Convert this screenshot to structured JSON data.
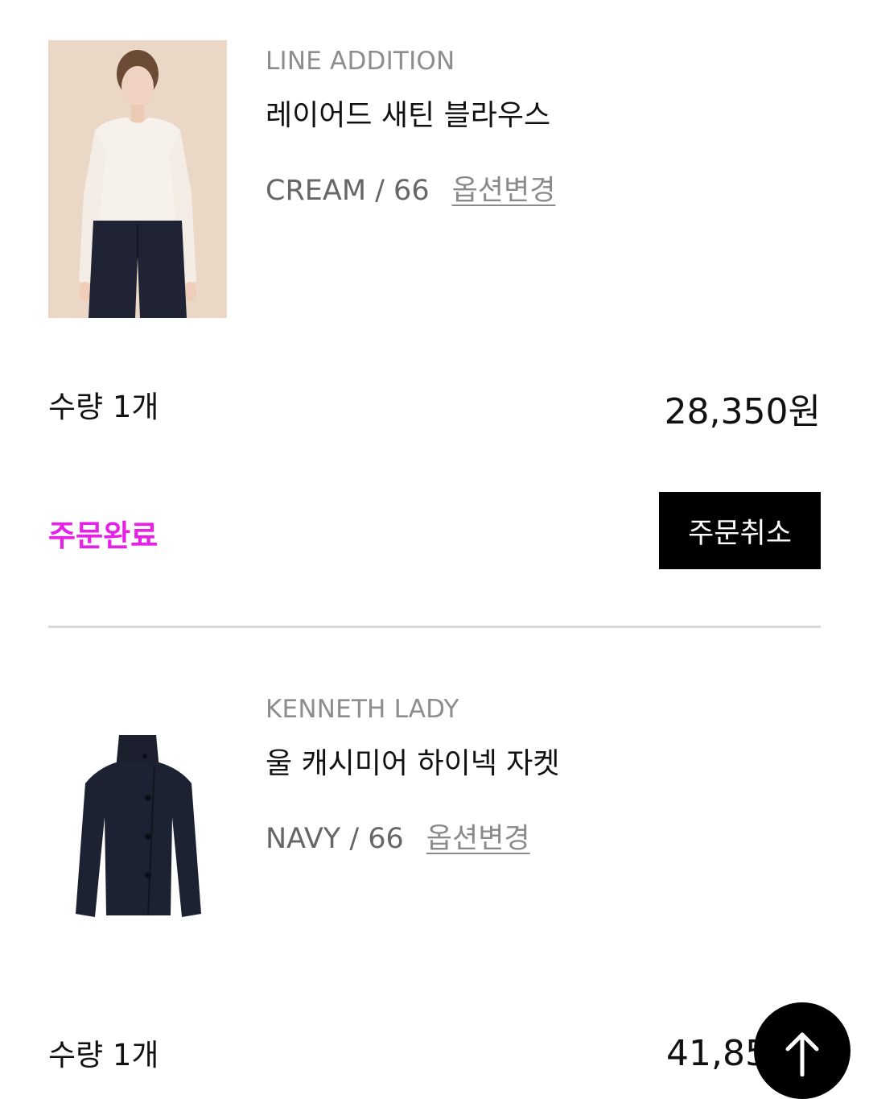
{
  "orders": [
    {
      "brand": "LINE ADDITION",
      "name": "레이어드 새틴 블라우스",
      "option": "CREAM / 66",
      "option_change_label": "옵션변경",
      "quantity": "수량 1개",
      "price": "28,350원",
      "status": "주문완료",
      "cancel_label": "주문취소",
      "image": "model-wearing-cream-blouse"
    },
    {
      "brand": "KENNETH LADY",
      "name": "울 캐시미어 하이넥 자켓",
      "option": "NAVY / 66",
      "option_change_label": "옵션변경",
      "quantity": "수량 1개",
      "price": "41,85",
      "image": "navy-highneck-jacket"
    }
  ],
  "colors": {
    "status_complete": "#e620e6",
    "button_bg": "#000000",
    "divider": "#d9d9d9"
  },
  "scroll_top_icon": "arrow-up-icon"
}
